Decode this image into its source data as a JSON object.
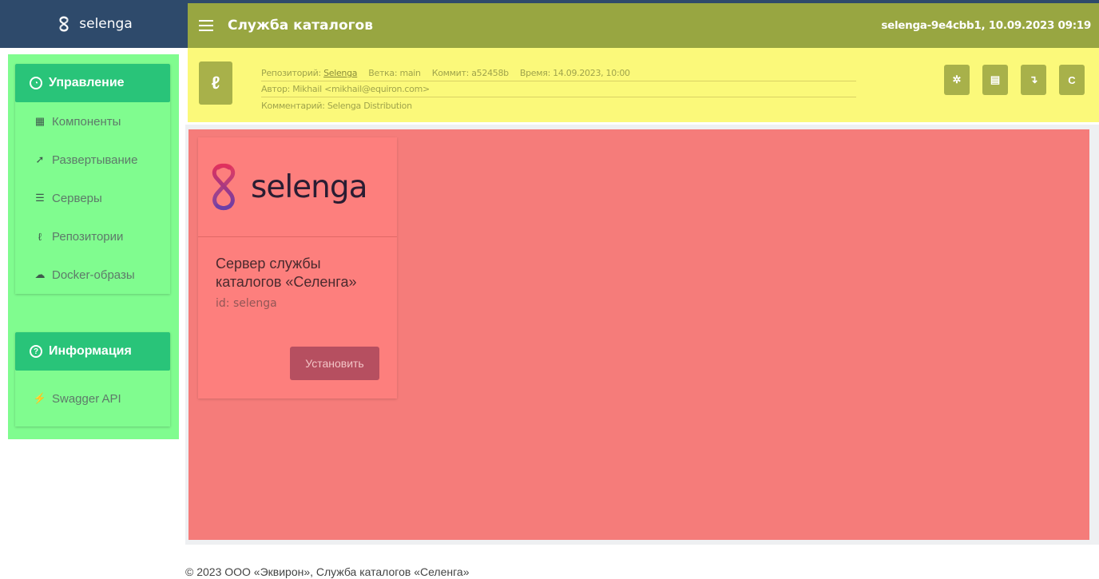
{
  "brand": {
    "name": "selenga",
    "colors": {
      "primary": "#e0315d",
      "secondary": "#6b3fa8"
    }
  },
  "topbar": {
    "title": "Служба каталогов",
    "instance_info": "selenga-9e4cbb1, 10.09.2023 09:19"
  },
  "sidebar": {
    "sections": [
      {
        "header": "Управление",
        "icon": "gauge-icon",
        "items": [
          {
            "label": "Компоненты",
            "icon": "grid-icon"
          },
          {
            "label": "Развертывание",
            "icon": "paper-plane-icon"
          },
          {
            "label": "Серверы",
            "icon": "server-icon"
          },
          {
            "label": "Репозитории",
            "icon": "branch-icon"
          },
          {
            "label": "Docker-образы",
            "icon": "cloud-icon"
          }
        ]
      },
      {
        "header": "Информация",
        "icon": "question-icon",
        "items": [
          {
            "label": "Swagger API",
            "icon": "plug-icon"
          }
        ]
      }
    ]
  },
  "repo": {
    "repository_label": "Репозиторий:",
    "repository_name": "Selenga",
    "branch": "Ветка: main",
    "commit": "Коммит: a52458b",
    "time": "Время: 14.09.2023, 10:00",
    "author": "Автор: Mikhail <mikhail@equiron.com>",
    "comment": "Комментарий: Selenga Distribution",
    "actions": [
      "settings-icon",
      "document-icon",
      "download-icon",
      "refresh-icon"
    ]
  },
  "card": {
    "logo_text": "selenga",
    "title": "Сервер службы каталогов «Селенга»",
    "id": "id: selenga",
    "button": "Установить"
  },
  "footer": {
    "text": "© 2023 ООО «Эквирон», Служба каталогов «Селенга»"
  }
}
